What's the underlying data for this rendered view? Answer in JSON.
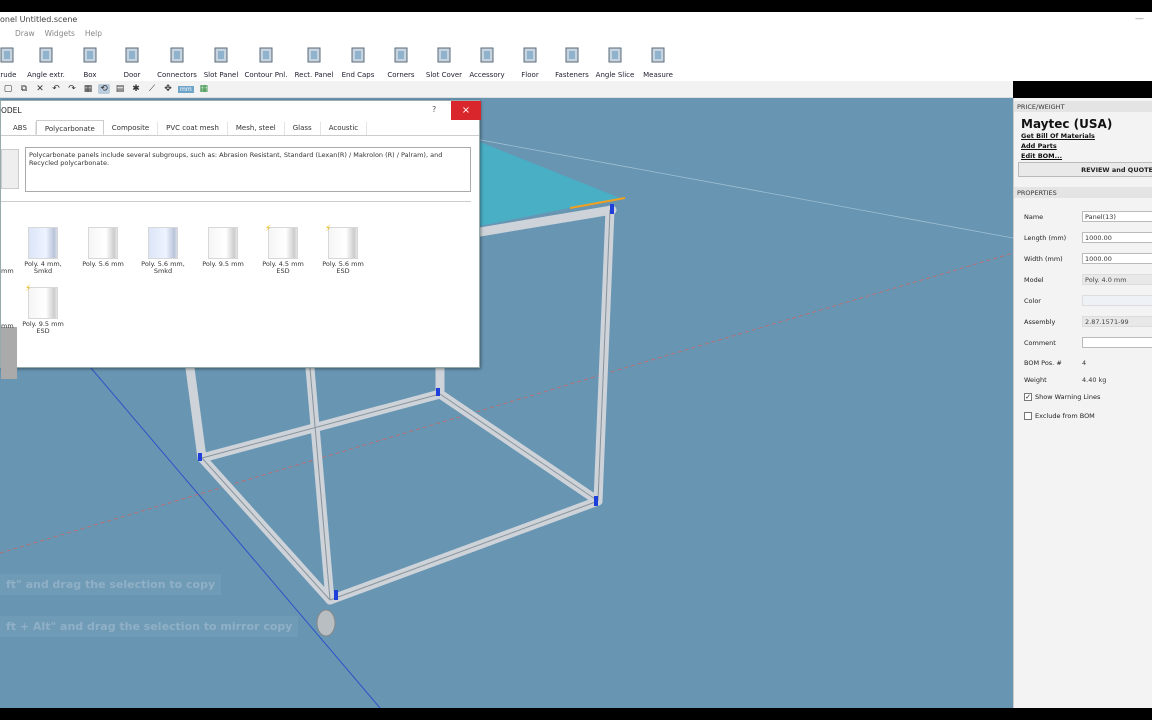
{
  "window": {
    "title": "onel Untitled.scene"
  },
  "menu": [
    "",
    "Draw",
    "Widgets",
    "Help"
  ],
  "toolbar": [
    {
      "label": "trude",
      "icon": "extrude-icon"
    },
    {
      "label": "Angle extr.",
      "icon": "angle-extrusion-icon"
    },
    {
      "label": "Box",
      "icon": "box-icon"
    },
    {
      "label": "Door",
      "icon": "door-icon"
    },
    {
      "label": "Connectors",
      "icon": "connectors-icon"
    },
    {
      "label": "Slot Panel",
      "icon": "slot-panel-icon"
    },
    {
      "label": "Contour Pnl.",
      "icon": "contour-panel-icon"
    },
    {
      "label": "Rect. Panel",
      "icon": "rect-panel-icon"
    },
    {
      "label": "End Caps",
      "icon": "end-caps-icon"
    },
    {
      "label": "Corners",
      "icon": "corners-icon"
    },
    {
      "label": "Slot Cover",
      "icon": "slot-cover-icon"
    },
    {
      "label": "Accessory",
      "icon": "accessory-icon"
    },
    {
      "label": "Floor",
      "icon": "floor-icon"
    },
    {
      "label": "Fasteners",
      "icon": "fasteners-icon"
    },
    {
      "label": "Angle Slice",
      "icon": "angle-slice-icon"
    },
    {
      "label": "Measure",
      "icon": "measure-icon"
    }
  ],
  "quick_access": {
    "unit": "mm"
  },
  "dialog": {
    "title": "ODEL",
    "help": "?",
    "close": "×",
    "tabs": [
      "ABS",
      "Polycarbonate",
      "Composite",
      "PVC coat mesh",
      "Mesh, steel",
      "Glass",
      "Acoustic"
    ],
    "active_tab": "Polycarbonate",
    "description": "Polycarbonate panels include several subgroups, such as: Abrasion Resistant, Standard (Lexan(R) / Makrolon (R) / Palram), and Recycled polycarbonate.",
    "left_cut_labels": [
      "mm",
      "mm"
    ],
    "parts": [
      {
        "name": "Poly. 4 mm, Smkd",
        "tint": "blue",
        "esd": false
      },
      {
        "name": "Poly. 5.6 mm",
        "tint": "clear",
        "esd": false
      },
      {
        "name": "Poly. 5.6 mm, Smkd",
        "tint": "blue",
        "esd": false
      },
      {
        "name": "Poly. 9.5 mm",
        "tint": "clear",
        "esd": false
      },
      {
        "name": "Poly. 4.5 mm ESD",
        "tint": "clear",
        "esd": true
      },
      {
        "name": "Poly. 5.6 mm ESD",
        "tint": "clear",
        "esd": true
      },
      {
        "name": "Poly. 9.5 mm ESD",
        "tint": "clear",
        "esd": true
      }
    ]
  },
  "viewport": {
    "hint1": "ft\" and drag the selection to copy",
    "hint2": "ft + Alt\" and drag the selection to mirror copy"
  },
  "panel": {
    "price_header": "PRICE/WEIGHT",
    "brand": "Maytec (USA)",
    "links": [
      "Get Bill Of Materials",
      "Add Parts",
      "Edit BOM..."
    ],
    "review_button": "REVIEW and QUOTE",
    "properties_header": "PROPERTIES",
    "rows": [
      {
        "label": "Name",
        "value": "Panel(13)",
        "kind": "input"
      },
      {
        "label": "Length (mm)",
        "value": "1000.00",
        "kind": "input"
      },
      {
        "label": "Width (mm)",
        "value": "1000.00",
        "kind": "input"
      },
      {
        "label": "Model",
        "value": "Poly. 4.0 mm",
        "kind": "readonly"
      },
      {
        "label": "Color",
        "value": "",
        "kind": "readonly"
      },
      {
        "label": "Assembly",
        "value": "2.87.1571-99",
        "kind": "readonly"
      },
      {
        "label": "Comment",
        "value": "",
        "kind": "input"
      },
      {
        "label": "BOM Pos. #",
        "value": "4",
        "kind": "text"
      },
      {
        "label": "Weight",
        "value": "4.40 kg",
        "kind": "text"
      }
    ],
    "checkboxes": [
      {
        "label": "Show Warning Lines",
        "checked": true
      },
      {
        "label": "Exclude from BOM",
        "checked": false
      }
    ]
  }
}
